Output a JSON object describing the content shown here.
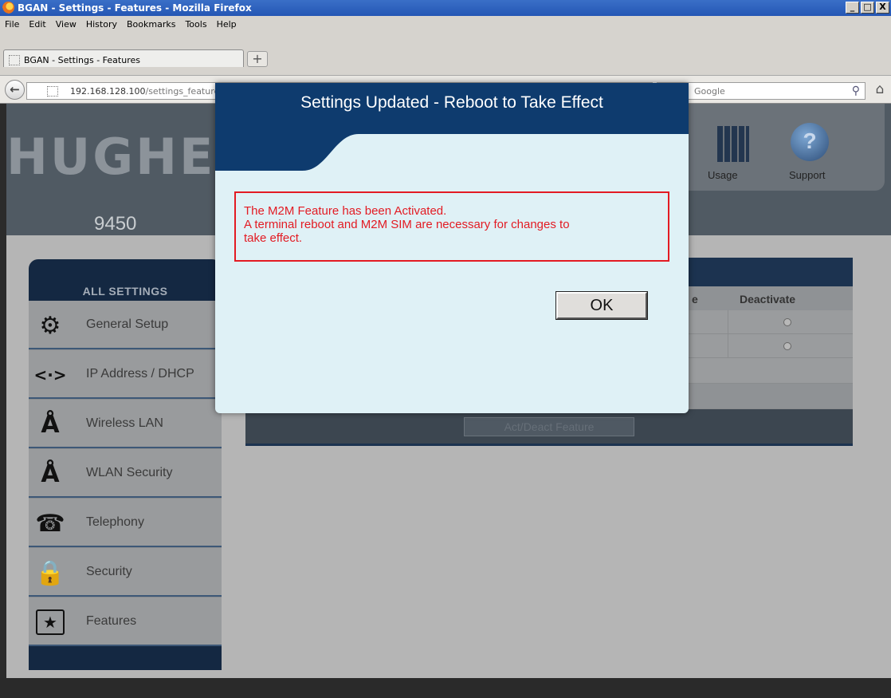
{
  "window": {
    "title": "BGAN - Settings - Features - Mozilla Firefox",
    "buttons": [
      "_",
      "□",
      "X"
    ]
  },
  "menubar": [
    "File",
    "Edit",
    "View",
    "History",
    "Bookmarks",
    "Tools",
    "Help"
  ],
  "tab": {
    "label": "BGAN - Settings - Features",
    "new_tab": "+"
  },
  "navbar": {
    "url_host": "192.168.128.100",
    "url_path": "/settings_features.html",
    "search_placeholder": "Google",
    "back": "←",
    "star": "☆",
    "dropdown": "▽",
    "reload": "C",
    "search_drop": "▾",
    "search_btn": "⚲",
    "home": "⌂"
  },
  "header": {
    "logo": "HUGHE",
    "model": "9450",
    "nav": [
      {
        "label": "Usage"
      },
      {
        "label": "Support",
        "glyph": "?"
      }
    ]
  },
  "sidebar": {
    "title": "ALL SETTINGS",
    "items": [
      {
        "label": "General Setup",
        "icon": "gear-icon",
        "glyph": "⚙"
      },
      {
        "label": "IP Address / DHCP",
        "icon": "network-arrows-icon",
        "glyph": "<·>"
      },
      {
        "label": "Wireless LAN",
        "icon": "antenna-icon",
        "glyph": "Å"
      },
      {
        "label": "WLAN Security",
        "icon": "antenna-lock-icon",
        "glyph": "Å"
      },
      {
        "label": "Telephony",
        "icon": "phone-icon",
        "glyph": "☎"
      },
      {
        "label": "Security",
        "icon": "lock-icon",
        "glyph": "🔒"
      },
      {
        "label": "Features",
        "icon": "puzzle-star-icon",
        "glyph": "★"
      }
    ]
  },
  "features_table": {
    "column_partial": "e",
    "column_deactivate": "Deactivate",
    "rows": 2,
    "action_button": "Act/Deact Feature"
  },
  "modal": {
    "title": "Settings Updated - Reboot to Take Effect",
    "message_lines": [
      "The M2M Feature has been Activated.",
      "A terminal reboot and M2M SIM are necessary for changes to",
      "take effect."
    ],
    "ok_label": "OK"
  },
  "colors": {
    "modal_header": "#0e3b6e",
    "modal_body": "#dff1f6",
    "message_red": "#e31b23"
  }
}
